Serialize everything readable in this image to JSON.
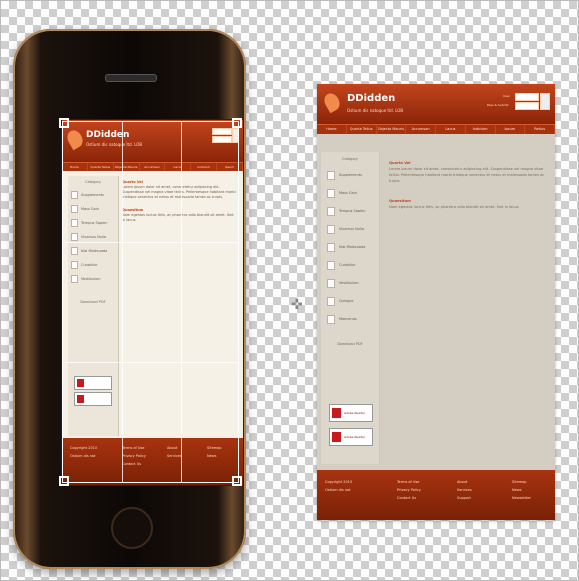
{
  "site": {
    "brand": "DDidden",
    "tagline": "Ostium dis natoque ltd. LOB",
    "login_label_user": "User",
    "login_label_pass": "Pass & Submit",
    "nav": [
      "Home",
      "Quarta Tellus",
      "Objecta Mauris",
      "Accumsan",
      "Lacus",
      "Indicium",
      "Ipsum",
      "Retius"
    ],
    "sidebar_title": "Category",
    "sidebar_items": [
      "Supplements",
      "Mass Gain",
      "Tempus Sapien",
      "Vivamus Nulla",
      "Nisi Malesuada",
      "Curabitur",
      "Vestibulum",
      "Quisque",
      "Maecenas"
    ],
    "main_heading_1": "Quarto Vel",
    "main_text_1": "Lorem ipsum dolor sit amet, consectetur adipiscing elit. Suspendisse vel magna vitae tellus. Pellentesque habitant morbi tristique senectus et netus et malesuada fames ac turpis.",
    "main_heading_2": "Quaesitum",
    "main_text_2": "Nam egestas luctus felis, ac pharetra odio blandit sit amet. Sed in lacus.",
    "downloads_title": "Download PDF",
    "pdf_labels": [
      "Adobe Reader",
      "Adobe Reader"
    ],
    "footer_left": [
      "Copyright 2010",
      "Ostium dis nat"
    ],
    "footer_cols": [
      [
        "Terms of Use",
        "Privacy Policy",
        "Contact Us"
      ],
      [
        "About",
        "Services",
        "Support"
      ],
      [
        "Sitemap",
        "News",
        "Newsletter"
      ]
    ]
  }
}
